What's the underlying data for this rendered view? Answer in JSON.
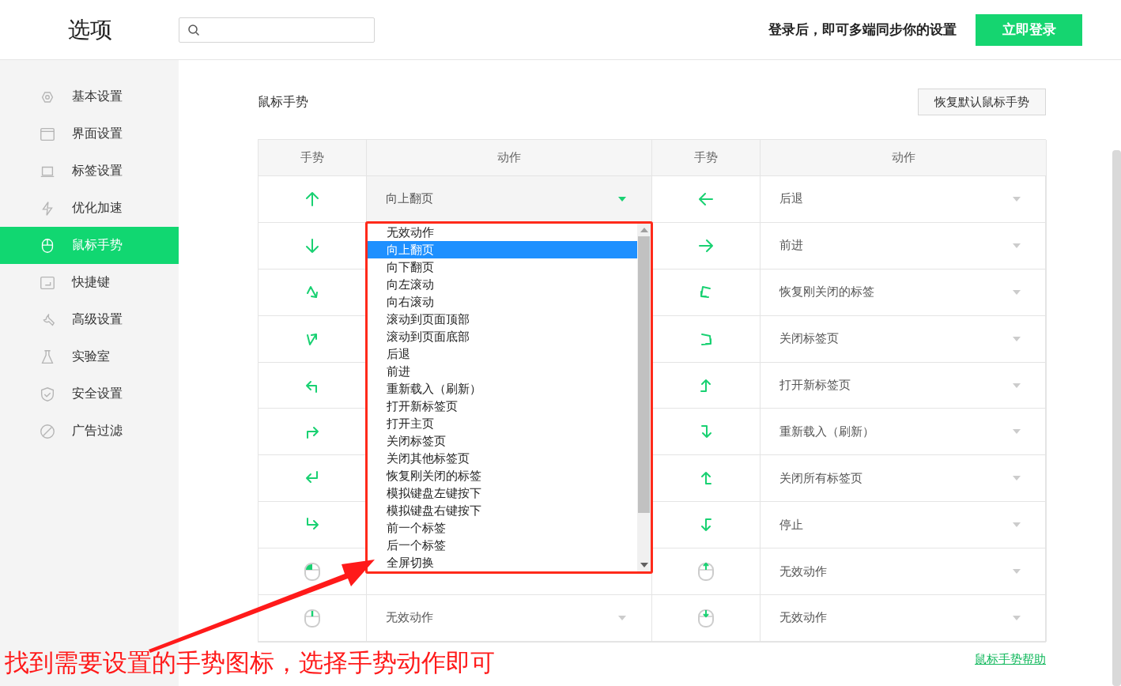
{
  "header": {
    "title": "选项",
    "sync_prompt": "登录后，即可多端同步你的设置",
    "login_button": "立即登录"
  },
  "sidebar": {
    "items": [
      {
        "label": "基本设置",
        "selected": false
      },
      {
        "label": "界面设置",
        "selected": false
      },
      {
        "label": "标签设置",
        "selected": false
      },
      {
        "label": "优化加速",
        "selected": false
      },
      {
        "label": "鼠标手势",
        "selected": true
      },
      {
        "label": "快捷键",
        "selected": false
      },
      {
        "label": "高级设置",
        "selected": false
      },
      {
        "label": "实验室",
        "selected": false
      },
      {
        "label": "安全设置",
        "selected": false
      },
      {
        "label": "广告过滤",
        "selected": false
      }
    ]
  },
  "section": {
    "title": "鼠标手势",
    "reset_button": "恢复默认鼠标手势"
  },
  "table": {
    "columns": [
      "手势",
      "动作",
      "手势",
      "动作"
    ],
    "rows": [
      {
        "left": {
          "action": "向上翻页",
          "open": true
        },
        "right": {
          "action": "后退",
          "open": false
        }
      },
      {
        "right": {
          "action": "前进",
          "open": false
        }
      },
      {
        "right": {
          "action": "恢复刚关闭的标签",
          "open": false
        }
      },
      {
        "right": {
          "action": "关闭标签页",
          "open": false
        }
      },
      {
        "right": {
          "action": "打开新标签页",
          "open": false
        }
      },
      {
        "right": {
          "action": "重新载入（刷新）",
          "open": false
        }
      },
      {
        "right": {
          "action": "关闭所有标签页",
          "open": false
        }
      },
      {
        "right": {
          "action": "停止",
          "open": false
        }
      },
      {
        "right": {
          "action": "无效动作",
          "open": false
        }
      },
      {
        "left": {
          "action": "无效动作",
          "open": false
        },
        "right": {
          "action": "无效动作",
          "open": false
        }
      }
    ],
    "dropdown": {
      "options": [
        {
          "label": "无效动作",
          "selected": false
        },
        {
          "label": "向上翻页",
          "selected": true
        },
        {
          "label": "向下翻页",
          "selected": false
        },
        {
          "label": "向左滚动",
          "selected": false
        },
        {
          "label": "向右滚动",
          "selected": false
        },
        {
          "label": "滚动到页面顶部",
          "selected": false
        },
        {
          "label": "滚动到页面底部",
          "selected": false
        },
        {
          "label": "后退",
          "selected": false
        },
        {
          "label": "前进",
          "selected": false
        },
        {
          "label": "重新载入（刷新）",
          "selected": false
        },
        {
          "label": "打开新标签页",
          "selected": false
        },
        {
          "label": "打开主页",
          "selected": false
        },
        {
          "label": "关闭标签页",
          "selected": false
        },
        {
          "label": "关闭其他标签页",
          "selected": false
        },
        {
          "label": "恢复刚关闭的标签",
          "selected": false
        },
        {
          "label": "模拟键盘左键按下",
          "selected": false
        },
        {
          "label": "模拟键盘右键按下",
          "selected": false
        },
        {
          "label": "前一个标签",
          "selected": false
        },
        {
          "label": "后一个标签",
          "selected": false
        },
        {
          "label": "全屏切换",
          "selected": false
        }
      ]
    }
  },
  "help_link": "鼠标手势帮助",
  "annotation": {
    "caption": "找到需要设置的手势图标，选择手势动作即可"
  }
}
